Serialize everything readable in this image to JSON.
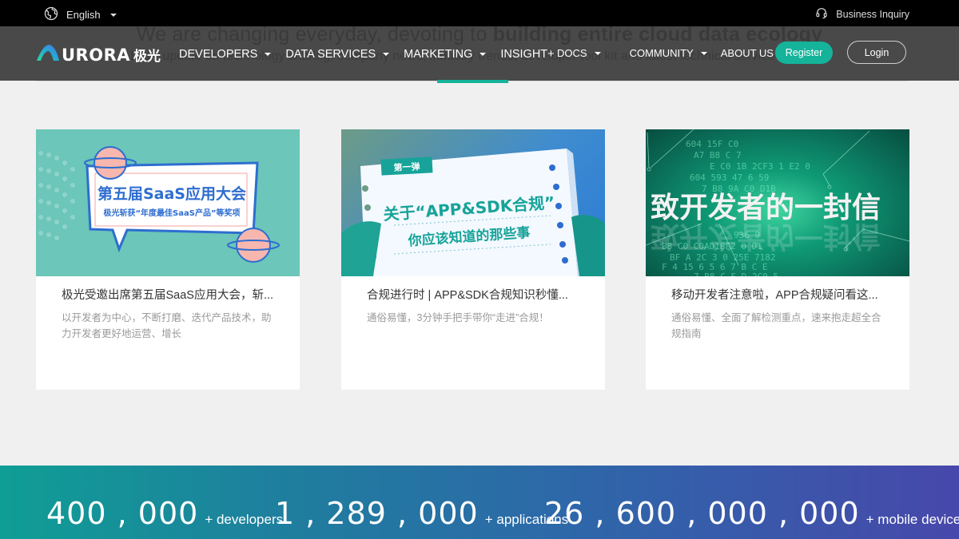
{
  "topbar": {
    "language": "English",
    "language_icon": "globe-icon",
    "business_inquiry": "Business Inquiry",
    "business_icon": "headset-icon"
  },
  "hero": {
    "title_plain": "We are changing everyday, devoting to ",
    "title_bold": "building entire cloud data ecology",
    "subtitle": "Daily update on technology sharing, company news, industry trends, developer tool kit and latest technical service solutions"
  },
  "nav": {
    "logo_text": "URORA",
    "logo_cn": "极光",
    "left_items": [
      {
        "label": "DEVELOPERS",
        "has_dropdown": true
      },
      {
        "label": "DATA SERVICES",
        "has_dropdown": true
      },
      {
        "label": "MARKETING",
        "has_dropdown": true
      },
      {
        "label": "INSIGHT+",
        "has_dropdown": false
      }
    ],
    "right_items": [
      {
        "label": "DOCS",
        "has_dropdown": true
      },
      {
        "label": "COMMUNITY",
        "has_dropdown": true
      },
      {
        "label": "ABOUT US",
        "has_dropdown": true
      }
    ],
    "register_label": "Register",
    "login_label": "Login"
  },
  "colors": {
    "accent": "#14b39a",
    "topbar": "#000000",
    "nav_overlay": "#3c3c3c",
    "page_bg": "#f0f0f0"
  },
  "cards": [
    {
      "title": "极光受邀出席第五届SaaS应用大会，斩...",
      "description": "以开发者为中心，不断打磨、迭代产品技术，助力开发者更好地运营、增长",
      "image_headline": "第五届SaaS应用大会",
      "image_subline": "极光斩获“年度最佳SaaS产品”等奖项"
    },
    {
      "title": "合规进行时 | APP&SDK合规知识秒懂...",
      "description": "通俗易懂，3分钟手把手带你“走进”合规！",
      "image_tag": "第一弹",
      "image_headline": "关于“APP&SDK合规”",
      "image_subline": "你应该知道的那些事"
    },
    {
      "title": "移动开发者注意啦，APP合规疑问看这...",
      "description": "通俗易懂、全面了解检测重点，速来抱走超全合规指南",
      "image_headline": "致开发者的一封信",
      "image_codes": [
        "604 15F C0",
        "A7 B8 C 7",
        "E C0 1B 2CF3 1 E2 0",
        "604 593 47 6 59",
        "7 B8 9A C0 D1B",
        "936 9",
        "B8 C0 C0AD1BF2 0 D1",
        "BF A 2C 3 0 25E 7182",
        "F 4 15 6 5 6 7 B C E",
        "7 B8 C F D 2C0 5"
      ]
    }
  ],
  "stats": [
    {
      "number": "400 , 000",
      "label": "+ developers"
    },
    {
      "number": "1 , 289 , 000",
      "label": "+ applications"
    },
    {
      "number": "26 , 600 , 000 , 000",
      "label": "+ mobile devices"
    }
  ]
}
